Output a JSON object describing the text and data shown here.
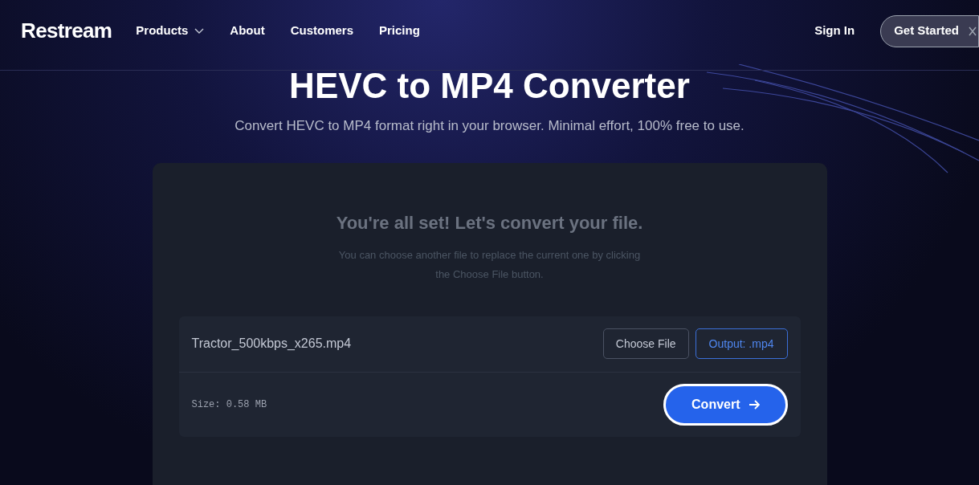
{
  "header": {
    "logo": "Restream",
    "nav": [
      {
        "label": "Products",
        "has_menu": true
      },
      {
        "label": "About",
        "has_menu": false
      },
      {
        "label": "Customers",
        "has_menu": false
      },
      {
        "label": "Pricing",
        "has_menu": false
      }
    ],
    "sign_in": "Sign In",
    "get_started": "Get Started"
  },
  "hero": {
    "title": "HEVC to MP4 Converter",
    "subtitle": "Convert HEVC to MP4 format right in your browser. Minimal effort, 100% free to use."
  },
  "card": {
    "heading": "You're all set! Let's convert your file.",
    "description": "You can choose another file to replace the current one by clicking the Choose File button.",
    "file_name": "Tractor_500kbps_x265.mp4",
    "choose_button": "Choose File",
    "output_button": "Output: .mp4",
    "size": "Size: 0.58 MB",
    "convert_button": "Convert"
  }
}
